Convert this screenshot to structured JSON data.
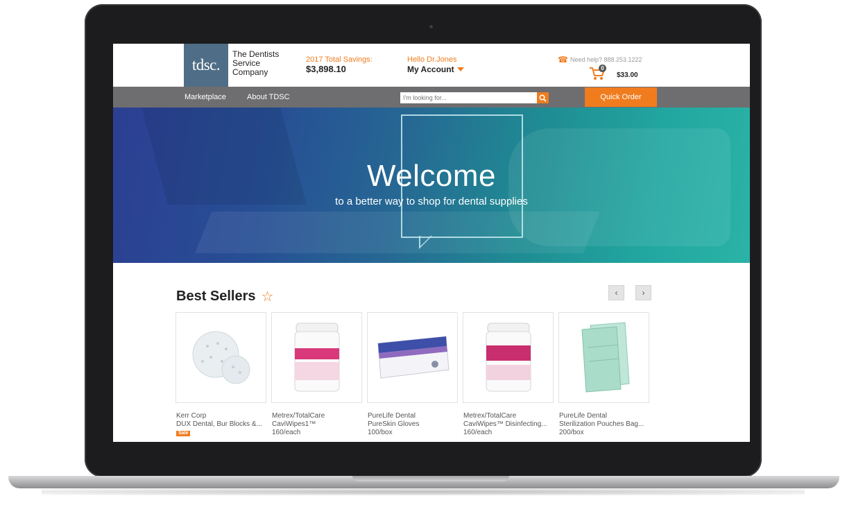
{
  "header": {
    "logo_text": "tdsc.",
    "company_name": [
      "The Dentists",
      "Service",
      "Company"
    ],
    "savings_label": "2017 Total Savings:",
    "savings_value": "$3,898.10",
    "greeting": "Hello Dr.Jones",
    "account_label": "My Account",
    "help_text": "Need help? 888.253.1222",
    "cart_count": "0",
    "cart_total": "$33.00"
  },
  "nav": {
    "items": [
      {
        "label": "Marketplace"
      },
      {
        "label": "About TDSC"
      }
    ],
    "search_placeholder": "I'm looking for...",
    "quick_order_label": "Quick Order"
  },
  "hero": {
    "title": "Welcome",
    "subtitle": "to a better way to shop for dental supplies"
  },
  "best_sellers": {
    "title": "Best Sellers",
    "prev_label": "‹",
    "next_label": "›",
    "products": [
      {
        "brand": "Kerr Corp",
        "name": "DUX Dental, Bur Blocks &...",
        "qty": "",
        "badge": "Sale"
      },
      {
        "brand": "Metrex/TotalCare",
        "name": "CaviWipes1™",
        "qty": "160/each",
        "badge": ""
      },
      {
        "brand": "PureLife Dental",
        "name": "PureSkin Gloves",
        "qty": "100/box",
        "badge": ""
      },
      {
        "brand": "Metrex/TotalCare",
        "name": "CaviWipes™ Disinfecting...",
        "qty": "160/each",
        "badge": ""
      },
      {
        "brand": "PureLife Dental",
        "name": "Sterilization Pouches Bag...",
        "qty": "200/box",
        "badge": ""
      }
    ]
  },
  "colors": {
    "accent": "#f07c1e",
    "nav_bg": "#6e6e70",
    "logo_bg": "#4f6d86"
  }
}
